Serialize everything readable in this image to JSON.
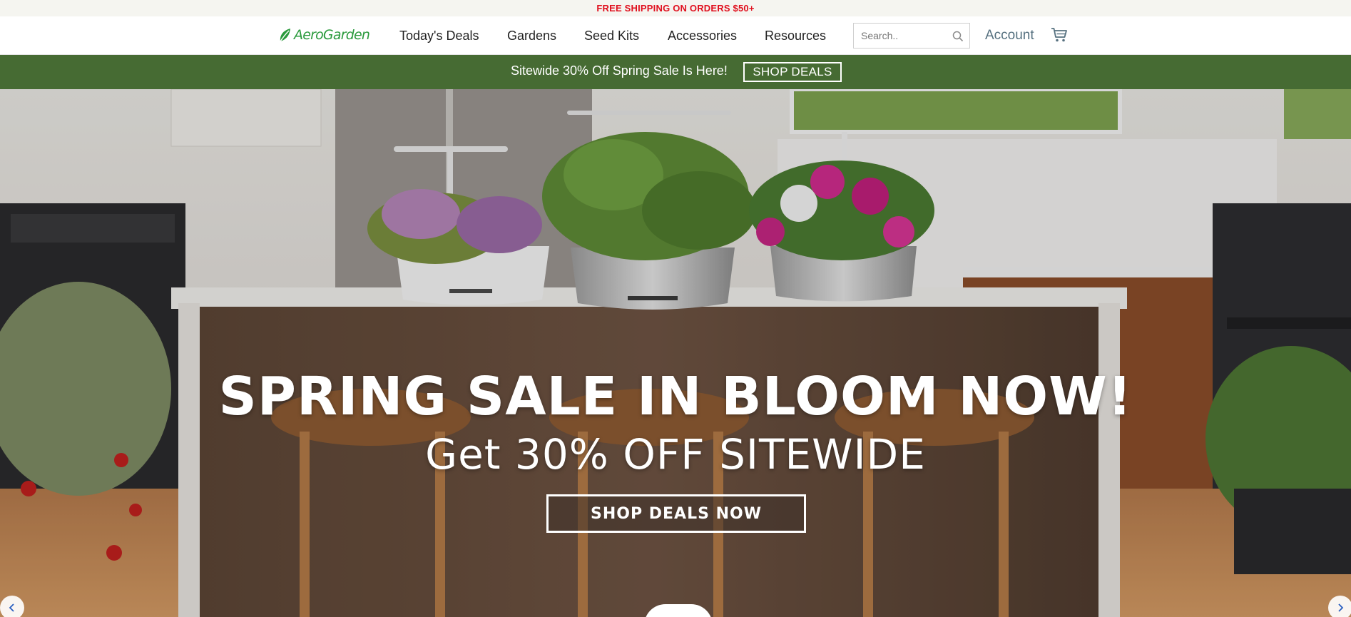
{
  "promo": {
    "text": "FREE SHIPPING ON ORDERS $50+"
  },
  "header": {
    "logo_text": "AeroGarden",
    "nav": [
      {
        "label": "Today's Deals"
      },
      {
        "label": "Gardens"
      },
      {
        "label": "Seed Kits"
      },
      {
        "label": "Accessories"
      },
      {
        "label": "Resources"
      }
    ],
    "search": {
      "placeholder": "Search..",
      "value": ""
    },
    "account_label": "Account",
    "icons": {
      "search": "search-icon",
      "cart": "cart-icon"
    }
  },
  "sale_banner": {
    "text": "Sitewide 30% Off Spring Sale Is Here!",
    "button_label": "SHOP DEALS",
    "background": "#466b33"
  },
  "hero": {
    "headline": "SPRING SALE IN BLOOM NOW!",
    "subheadline": "Get 30% OFF SITEWIDE",
    "cta_label": "SHOP DEALS NOW",
    "icons": {
      "prev": "chevron-left-icon",
      "next": "chevron-right-icon"
    }
  },
  "colors": {
    "promo_text": "#e0101e",
    "brand_green": "#2a9a3c",
    "account_text": "#55707f"
  }
}
